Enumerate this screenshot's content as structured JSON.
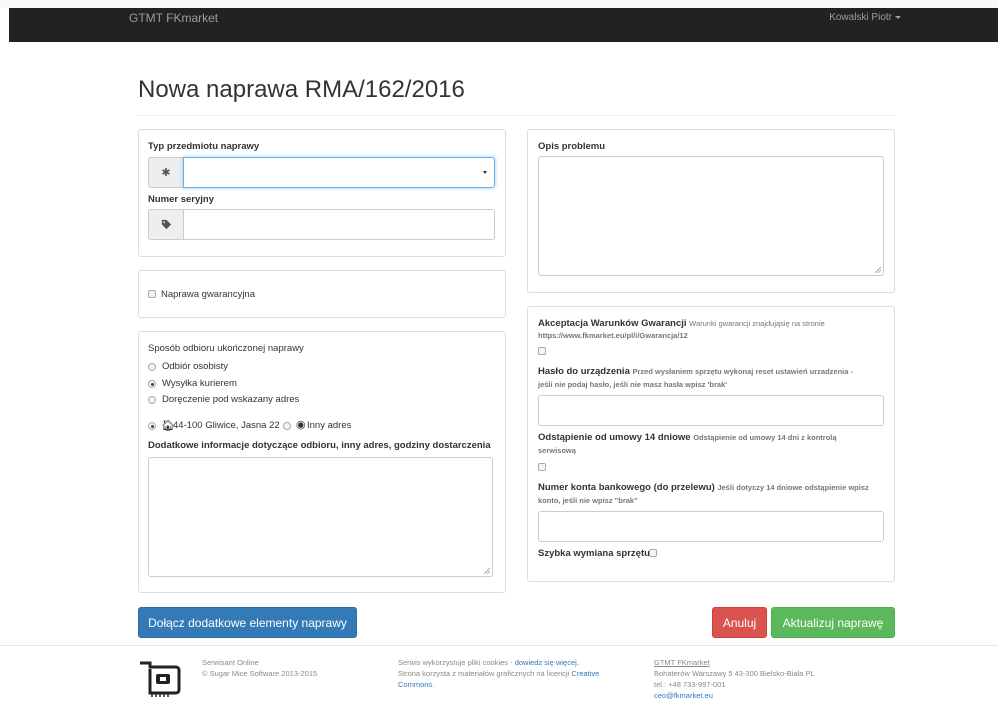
{
  "navbar": {
    "brand": "GTMT FKmarket",
    "user": "Kowalski Piotr"
  },
  "page": {
    "title": "Nowa naprawa RMA/162/2016"
  },
  "left": {
    "item_type_label": "Typ przedmiotu naprawy",
    "item_type_value": "",
    "serial_label": "Numer seryjny",
    "serial_value": "",
    "warranty_label": "Naprawa gwarancyjna",
    "pickup_title": "Sposób odbioru ukończonej naprawy",
    "pickup_options": [
      "Odbiór osobisty",
      "Wysyłka kurierem",
      "Doręczenie pod wskazany adres"
    ],
    "pickup_selected": "Wysyłka kurierem",
    "address_option": "44-100 Gliwice, Jasna 22",
    "other_address_option": "Inny adres",
    "extra_info_label": "Dodatkowe informacje dotyczące odbioru, inny adres, godziny dostarczenia",
    "extra_info_value": ""
  },
  "right": {
    "problem_label": "Opis problemu",
    "problem_value": "",
    "terms_label": "Akceptacja Warunków Gwarancji",
    "terms_help_1": "Warunki gwarancji znajdująsię na stronie",
    "terms_help_2": "https://www.fkmarket.eu/pl/i/Gwarancja/12",
    "password_label": "Hasło do urządzenia",
    "password_help_1": "Przed wysłaniem sprzętu wykonaj reset ustawień urzadzenia -",
    "password_help_2": "jeśli nie podaj hasło, jeśli nie masz hasła wpisz 'brak'",
    "password_value": "",
    "withdrawal_label": "Odstąpienie od umowy 14 dniowe",
    "withdrawal_help_1": "Odstąpienie od umowy 14 dni z kontrolą",
    "withdrawal_help_2": "serwisową",
    "bank_label": "Numer konta bankowego (do przelewu)",
    "bank_help_1": "Jeśli dotyczy 14 dniowe odstąpienie wpisz",
    "bank_help_2": "konto, jeśli nie wpisz \"brak\"",
    "bank_value": "",
    "quick_swap_label": "Szybka wymiana sprzętu"
  },
  "actions": {
    "add_elements": "Dołącz dodatkowe elementy naprawy",
    "cancel": "Anuluj",
    "update": "Aktualizuj naprawę"
  },
  "footer": {
    "app_name": "Serwisant Online",
    "copyright": "© Sugar Mice Software 2013-2015",
    "cookies_text": "Serwis wykorzystuje pliki cookies - ",
    "cookies_link": "dowiedz się więcej.",
    "materials_text": "Strona korzysta z materiałów graficznych na licencji ",
    "materials_link": "Creative",
    "materials_link_2": "Commons",
    "materials_end": ".",
    "company": "GTMT FKmarket",
    "address": "Bohaterów Warszawy 5 43-300 Bielsko-Biała PL",
    "phone": "tel.: +48 733-997-001",
    "email": "ceo@fkmarket.eu"
  },
  "colors": {
    "navbar": "#222222",
    "primary": "#337ab7",
    "danger": "#d9534f",
    "success": "#5cb85c"
  }
}
